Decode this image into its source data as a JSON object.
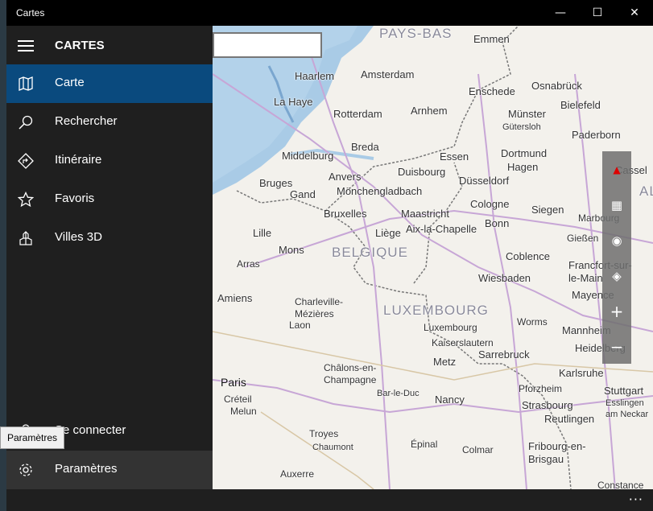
{
  "window": {
    "title": "Cartes",
    "minimize": "—",
    "maximize": "☐",
    "close": "✕"
  },
  "sidebar": {
    "app_title": "CARTES",
    "items": [
      {
        "label": "Carte",
        "icon": "map-icon"
      },
      {
        "label": "Rechercher",
        "icon": "search-icon"
      },
      {
        "label": "Itinéraire",
        "icon": "directions-icon"
      },
      {
        "label": "Favoris",
        "icon": "star-icon"
      },
      {
        "label": "Villes 3D",
        "icon": "3d-cities-icon"
      }
    ],
    "sign_in": "Se connecter",
    "settings": "Paramètres",
    "tooltip": "Paramètres"
  },
  "map": {
    "countries": [
      "PAYS-BAS",
      "BELGIQUE",
      "LUXEMBOURG",
      "ALLE"
    ],
    "cities": [
      "Emmen",
      "Haarlem",
      "Amsterdam",
      "Osnabrück",
      "La Haye",
      "Enschede",
      "Bielefeld",
      "Rotterdam",
      "Arnhem",
      "Münster",
      "Gütersloh",
      "Paderborn",
      "Breda",
      "Middelburg",
      "Essen",
      "Dortmund",
      "Hagen",
      "Cassel",
      "Bruges",
      "Anvers",
      "Duisbourg",
      "Düsseldorf",
      "Gand",
      "Mönchengladbach",
      "Cologne",
      "Bruxelles",
      "Maastricht",
      "Bonn",
      "Siegen",
      "Marbourg",
      "Lille",
      "Liège",
      "Aix-la-Chapelle",
      "Gießen",
      "Mons",
      "Coblence",
      "Francfort-sur-le-Main",
      "Arras",
      "Wiesbaden",
      "Amiens",
      "Charleville-Mézières",
      "Mayence",
      "Laon",
      "Luxembourg",
      "Worms",
      "Mannheim",
      "Kaiserslautern",
      "Heidelberg",
      "Sarrebruck",
      "Metz",
      "Karlsruhe",
      "Paris",
      "Châlons-en-Champagne",
      "Bar-le-Duc",
      "Nancy",
      "Pforzheim",
      "Stuttgart",
      "Créteil",
      "Strasbourg",
      "Esslingen am Neckar",
      "Melun",
      "Reutlingen",
      "Troyes",
      "Épinal",
      "Fribourg-en-Brisgau",
      "Chaumont",
      "Colmar",
      "Auxerre",
      "Constance"
    ],
    "tools": [
      "compass-icon",
      "map-view-icon",
      "locate-icon",
      "layers-icon",
      "zoom-in-icon",
      "zoom-out-icon"
    ]
  },
  "bottombar": {
    "more": "···"
  }
}
